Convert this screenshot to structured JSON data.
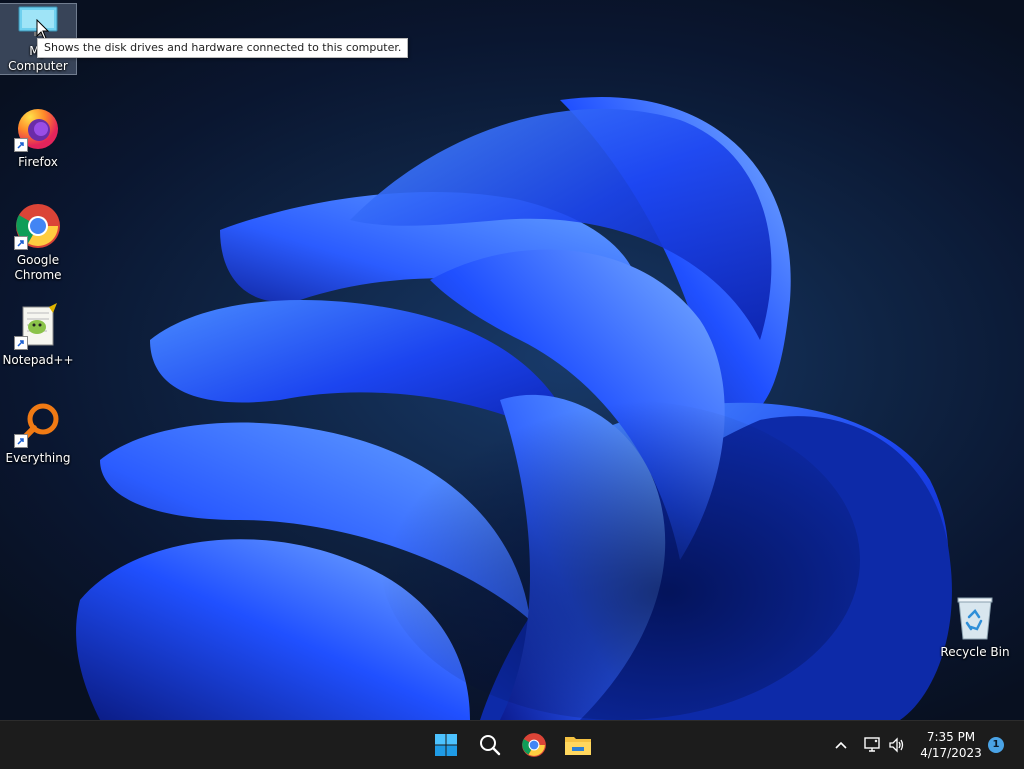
{
  "desktop": {
    "icons": [
      {
        "label": "My Computer",
        "icon": "computer-icon"
      },
      {
        "label": "Firefox",
        "icon": "firefox-icon"
      },
      {
        "label": "Google\nChrome",
        "icon": "chrome-icon"
      },
      {
        "label": "Notepad++",
        "icon": "notepadpp-icon"
      },
      {
        "label": "Everything",
        "icon": "everything-icon"
      },
      {
        "label": "Recycle Bin",
        "icon": "recycle-bin-icon"
      }
    ],
    "tooltip": "Shows the disk drives and hardware connected to this computer.",
    "wallpaper": "windows-11-bloom"
  },
  "taskbar": {
    "pinned": [
      {
        "icon": "start-icon"
      },
      {
        "icon": "search-icon"
      },
      {
        "icon": "chrome-icon"
      },
      {
        "icon": "file-explorer-icon"
      }
    ],
    "tray": {
      "icons": [
        "chevron-up-icon",
        "network-icon",
        "volume-icon"
      ],
      "time": "7:35 PM",
      "date": "4/17/2023",
      "notification_count": "1"
    }
  },
  "colors": {
    "accent": "#0067c0",
    "taskbar_bg": "#1c1c1c",
    "wallpaper_blue": "#1a4cff",
    "notification_badge": "#4aa3e6"
  }
}
